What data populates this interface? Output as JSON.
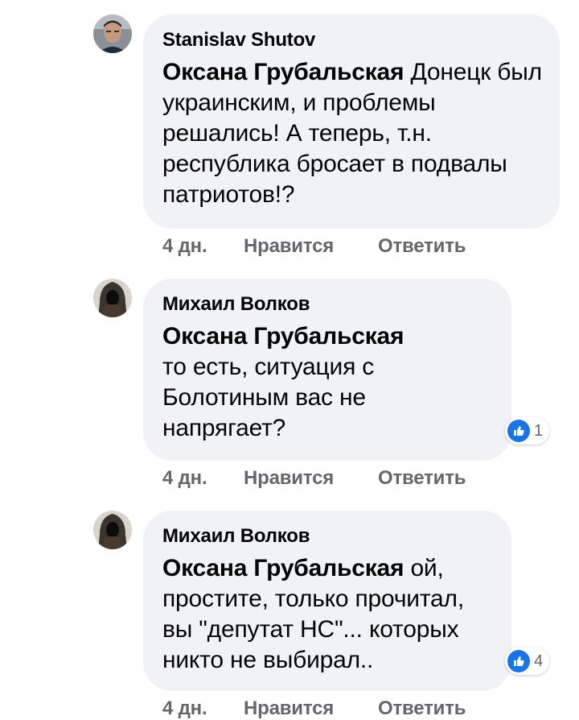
{
  "colors": {
    "bubble": "#f0f2f5",
    "action_text": "#65676b",
    "like_blue": "#1b74e4"
  },
  "comments": [
    {
      "author": "Stanislav Shutov",
      "mention": "Оксана Грубальская",
      "text": " Донецк был украинским, и проблемы решались! А теперь, т.н. республика бросает в подвалы патриотов!?",
      "time": "4 дн.",
      "like_label": "Нравится",
      "reply_label": "Ответить",
      "avatar_icon": "user-photo-avatar"
    },
    {
      "author": "Михаил Волков",
      "mention": "Оксана Грубальская",
      "text": " то есть, ситуация с Болотиным вас не напрягает?",
      "time": "4 дн.",
      "like_label": "Нравится",
      "reply_label": "Ответить",
      "reaction_icon": "like-icon",
      "reaction_count": "1",
      "avatar_icon": "hooded-figure-avatar"
    },
    {
      "author": "Михаил Волков",
      "mention": "Оксана Грубальская",
      "text": " ой, простите, только прочитал, вы \"депутат НС\"... которых никто не выбирал..",
      "time": "4 дн.",
      "like_label": "Нравится",
      "reply_label": "Ответить",
      "reaction_icon": "like-icon",
      "reaction_count": "4",
      "avatar_icon": "hooded-figure-avatar"
    }
  ]
}
